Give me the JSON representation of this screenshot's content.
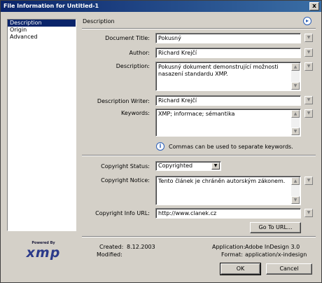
{
  "window": {
    "title": "File Information for Untitled-1",
    "close_label": "x"
  },
  "sidebar": {
    "items": [
      {
        "label": "Description",
        "selected": true
      },
      {
        "label": "Origin",
        "selected": false
      },
      {
        "label": "Advanced",
        "selected": false
      }
    ]
  },
  "logo": {
    "powered_by": "Powered By",
    "brand": "xmp"
  },
  "section": {
    "title": "Description"
  },
  "form": {
    "document_title": {
      "label": "Document Title:",
      "value": "Pokusný"
    },
    "author": {
      "label": "Author:",
      "value": "Richard Krejčí"
    },
    "description": {
      "label": "Description:",
      "value": "Pokusný dokument demonstrující možnosti nasazení standardu XMP."
    },
    "description_writer": {
      "label": "Description Writer:",
      "value": "Richard Krejčí"
    },
    "keywords": {
      "label": "Keywords:",
      "value": "XMP; informace; sémantika"
    },
    "keywords_hint": "Commas can be used to separate keywords.",
    "copyright_status": {
      "label": "Copyright Status:",
      "value": "Copyrighted"
    },
    "copyright_notice": {
      "label": "Copyright Notice:",
      "value": "Tento článek je chráněn autorským zákonem."
    },
    "copyright_url": {
      "label": "Copyright Info URL:",
      "value": "http://www.clanek.cz"
    },
    "goto_url_label": "Go To URL..."
  },
  "meta": {
    "created_label": "Created:",
    "created_value": "8.12.2003",
    "modified_label": "Modified:",
    "modified_value": "",
    "application_label": "Application:",
    "application_value": "Adobe InDesign 3.0",
    "format_label": "Format:",
    "format_value": "application/x-indesign"
  },
  "buttons": {
    "ok": "OK",
    "cancel": "Cancel"
  }
}
